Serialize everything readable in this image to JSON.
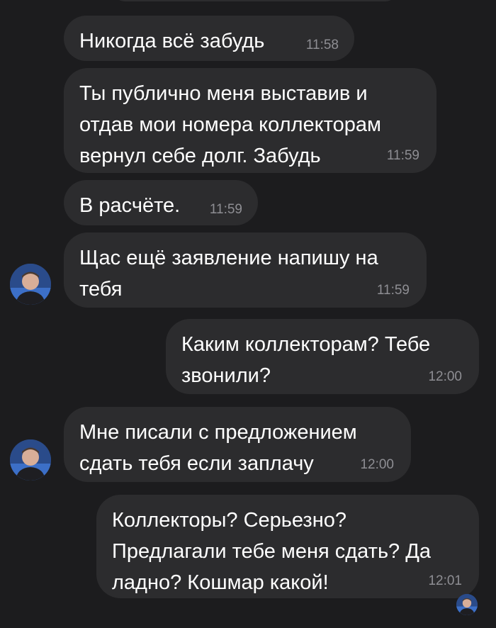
{
  "messages": [
    {
      "text": "Никогда всё забудь",
      "time": "11:58",
      "side": "in"
    },
    {
      "text": "Ты публично меня выставив и\nотдав мои номера коллекторам\nвернул себе долг. Забудь",
      "time": "11:59",
      "side": "in"
    },
    {
      "text": "В расчёте.",
      "time": "11:59",
      "side": "in"
    },
    {
      "text": "Щас ещё заявление напишу на\nтебя",
      "time": "11:59",
      "side": "in"
    },
    {
      "text": "Каким коллекторам? Тебе\nзвонили?",
      "time": "12:00",
      "side": "out"
    },
    {
      "text": "Мне писали с предложением\nсдать тебя если заплачу",
      "time": "12:00",
      "side": "in"
    },
    {
      "text": "Коллекторы? Серьезно?\nПредлагали тебе меня сдать? Да\nладно? Кошмар какой!",
      "time": "12:01",
      "side": "out"
    }
  ],
  "colors": {
    "background": "#1c1c1e",
    "bubble": "#2c2c2e",
    "time": "#8e8e93",
    "avatar_bg": "#2a4b8a"
  },
  "icons": {
    "contact_avatar": "avatar-icon",
    "read_receipt_avatar": "avatar-icon"
  }
}
